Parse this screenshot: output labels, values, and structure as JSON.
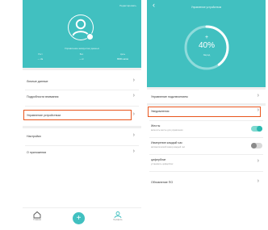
{
  "left_screen": {
    "header": {
      "top_right_link": "Редактировать",
      "username": "Управление аккаунтом данных",
      "stats": [
        {
          "label": "Рост",
          "value": "— см"
        },
        {
          "label": "Вес",
          "value": "— кг"
        },
        {
          "label": "Цель",
          "value": "8000 шагов"
        }
      ]
    },
    "menu": [
      {
        "label": "Личные данные"
      },
      {
        "label": "Подробности внимания"
      },
      {
        "label": "Управление устройством",
        "highlighted": true
      },
      {
        "label": "Настройки"
      },
      {
        "label": "О приложении"
      }
    ],
    "tabbar": {
      "home_label": "Главная",
      "fab_symbol": "+",
      "profile_label": "Профиль"
    },
    "colors": {
      "accent": "#41c0c0",
      "highlight": "#e8551c"
    }
  },
  "right_screen": {
    "title": "Управление устройством",
    "gauge": {
      "plus": "+",
      "value_text": "40%",
      "value": 0.4,
      "sub": "Заряд"
    },
    "rows": [
      {
        "label": "Управление подключением",
        "type": "arrow"
      },
      {
        "label": "Уведомления",
        "type": "arrow",
        "highlighted": true
      },
      {
        "label": "Жесты",
        "sub": "включить жесты для управления",
        "type": "toggle",
        "on": true
      },
      {
        "label": "Измерение каждый час",
        "sub": "автоматический замер каждый час",
        "type": "toggle",
        "on": false
      },
      {
        "label": "циферблат",
        "sub": "установить циферблат",
        "type": "arrow"
      },
      {
        "label": "Обновление ПО",
        "type": "arrow"
      }
    ],
    "arrow_glyph": "›",
    "back_glyph": "‹"
  }
}
